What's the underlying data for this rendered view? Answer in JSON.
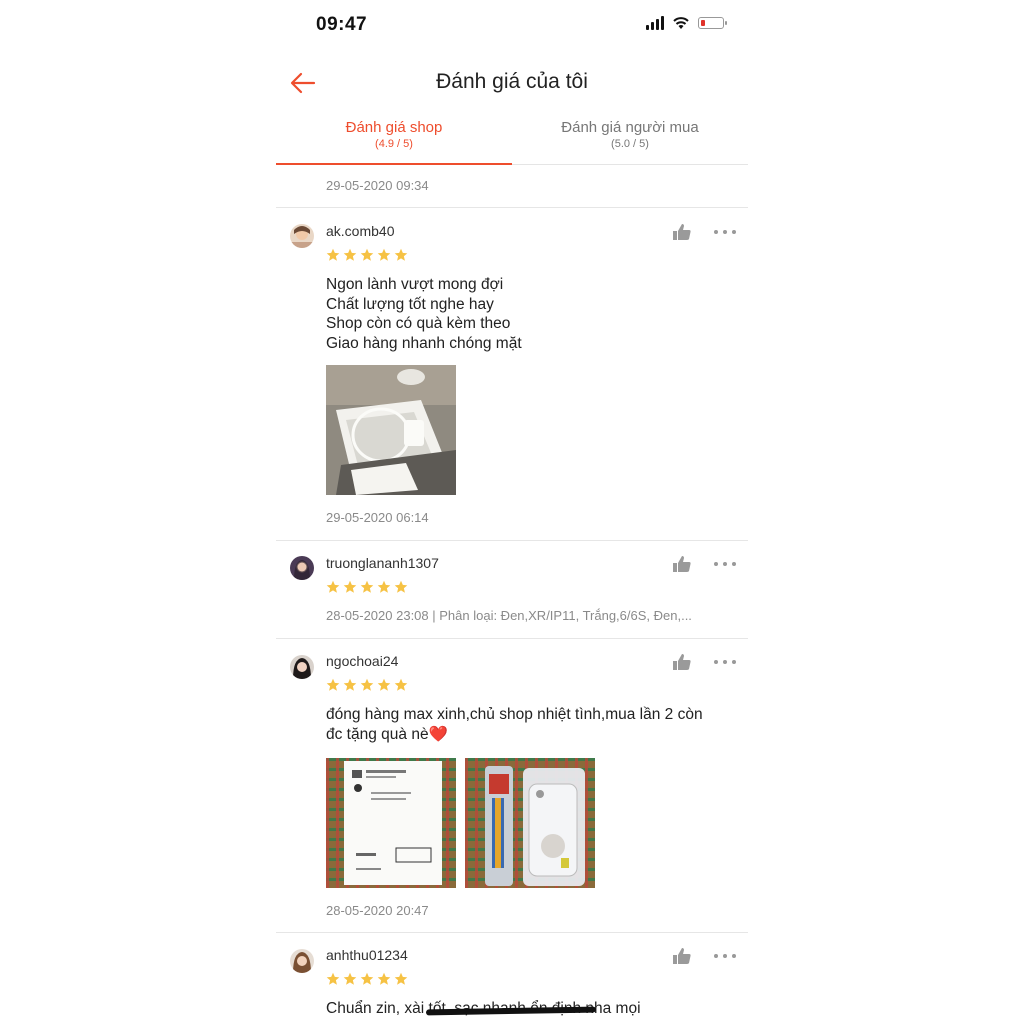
{
  "status": {
    "time": "09:47"
  },
  "header": {
    "title": "Đánh giá của tôi"
  },
  "tabs": [
    {
      "label": "Đánh giá shop",
      "sub": "(4.9 / 5)",
      "active": true
    },
    {
      "label": "Đánh giá người mua",
      "sub": "(5.0 / 5)",
      "active": false
    }
  ],
  "first_date": "29-05-2020 09:34",
  "colors": {
    "accent": "#ee4d2d",
    "star": "#f6c244",
    "muted": "#8a8a8a"
  },
  "reviews": [
    {
      "username": "ak.comb40",
      "rating": 5,
      "text": "Ngon lành vượt mong đợi\nChất lượng tốt nghe hay\nShop còn có quà kèm theo\nGiao hàng nhanh chóng mặt",
      "meta": "29-05-2020 06:14",
      "photos": [
        "charger-box-photo"
      ]
    },
    {
      "username": "truonglananh1307",
      "rating": 5,
      "text": "",
      "meta": "28-05-2020 23:08 | Phân loại: Đen,XR/IP11, Trắng,6/6S, Đen,...",
      "photos": []
    },
    {
      "username": "ngochoai24",
      "rating": 5,
      "text": "đóng hàng max xinh,chủ shop nhiệt tình,mua lần 2 còn\nđc tặng quà nè",
      "emoji": "❤️",
      "meta": "28-05-2020 20:47",
      "photos": [
        "receipt-photo",
        "phone-case-photo"
      ]
    },
    {
      "username": "anhthu01234",
      "rating": 5,
      "text": "Chuẩn zin, xài tốt, sạc nhanh ổn định nha mọi",
      "meta": "",
      "photos": []
    }
  ]
}
